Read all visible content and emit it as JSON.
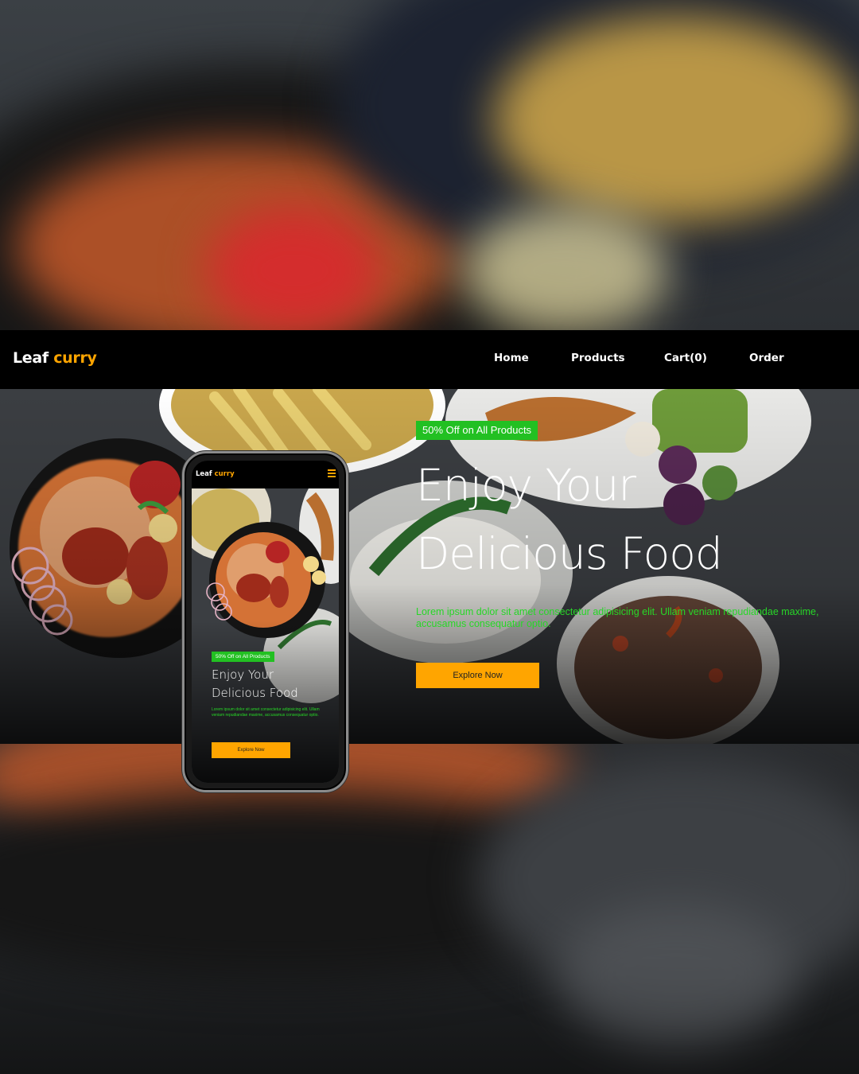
{
  "brand": {
    "name": "Leaf",
    "accent": "curry",
    "accent_color": "#ffa500"
  },
  "nav": {
    "links": [
      {
        "label": "Home"
      },
      {
        "label": "Products"
      },
      {
        "label": "Cart(0)"
      },
      {
        "label": "Order"
      }
    ]
  },
  "hero": {
    "badge": "50% Off on All Products",
    "headline_line1": "Enjoy Your",
    "headline_line2": "Delicious Food",
    "description": "Lorem ipsum dolor sit amet consectetur adipisicing elit. Ullam veniam repudiandae maxime, accusamus consequatur optio.",
    "cta": "Explore Now"
  },
  "icons": {
    "menu": "hamburger-menu-icon"
  },
  "colors": {
    "badge_bg": "#22c022",
    "description_text": "#27d727",
    "cta_bg": "#ffa500",
    "nav_bg": "#000000"
  }
}
